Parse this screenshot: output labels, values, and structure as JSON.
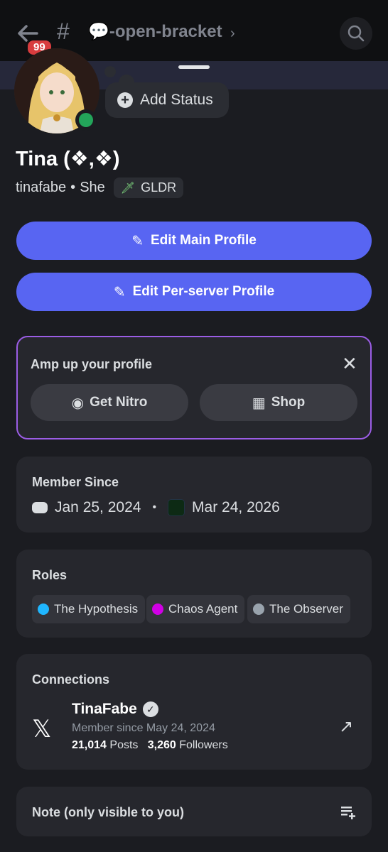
{
  "header": {
    "badge_count": "99",
    "channel_name": "💬-open-bracket",
    "chevron": "›",
    "icons": [
      "back-arrow-icon",
      "hash-lock-icon",
      "search-icon"
    ]
  },
  "status": {
    "add_label": "Add Status",
    "presence": "online",
    "presence_color": "#23a55a"
  },
  "profile": {
    "display_name": "Tina (❖,❖)",
    "username": "tinafabe",
    "separator": "•",
    "pronouns": "She",
    "guild_tag": "GLDR"
  },
  "buttons": {
    "edit_main": "Edit Main Profile",
    "edit_server": "Edit Per-server Profile",
    "accent": "#5865f2"
  },
  "amp": {
    "title": "Amp up your profile",
    "close": "✕",
    "nitro": "Get Nitro",
    "shop": "Shop"
  },
  "member_since": {
    "title": "Member Since",
    "discord_date": "Jan 25, 2024",
    "dot": "•",
    "server_date": "Mar 24, 2026"
  },
  "roles": {
    "title": "Roles",
    "items": [
      {
        "name": "The Hypothesis",
        "color": "#1fb6ff"
      },
      {
        "name": "Chaos Agent",
        "color": "#d100e6"
      },
      {
        "name": "The Observer",
        "color": "#99a3ad"
      }
    ]
  },
  "connections": {
    "title": "Connections",
    "account": "TinaFabe",
    "since": "Member since May 24, 2024",
    "posts": "21,014",
    "posts_label": "Posts",
    "followers": "3,260",
    "followers_label": "Followers"
  },
  "note": {
    "label": "Note (only visible to you)"
  }
}
